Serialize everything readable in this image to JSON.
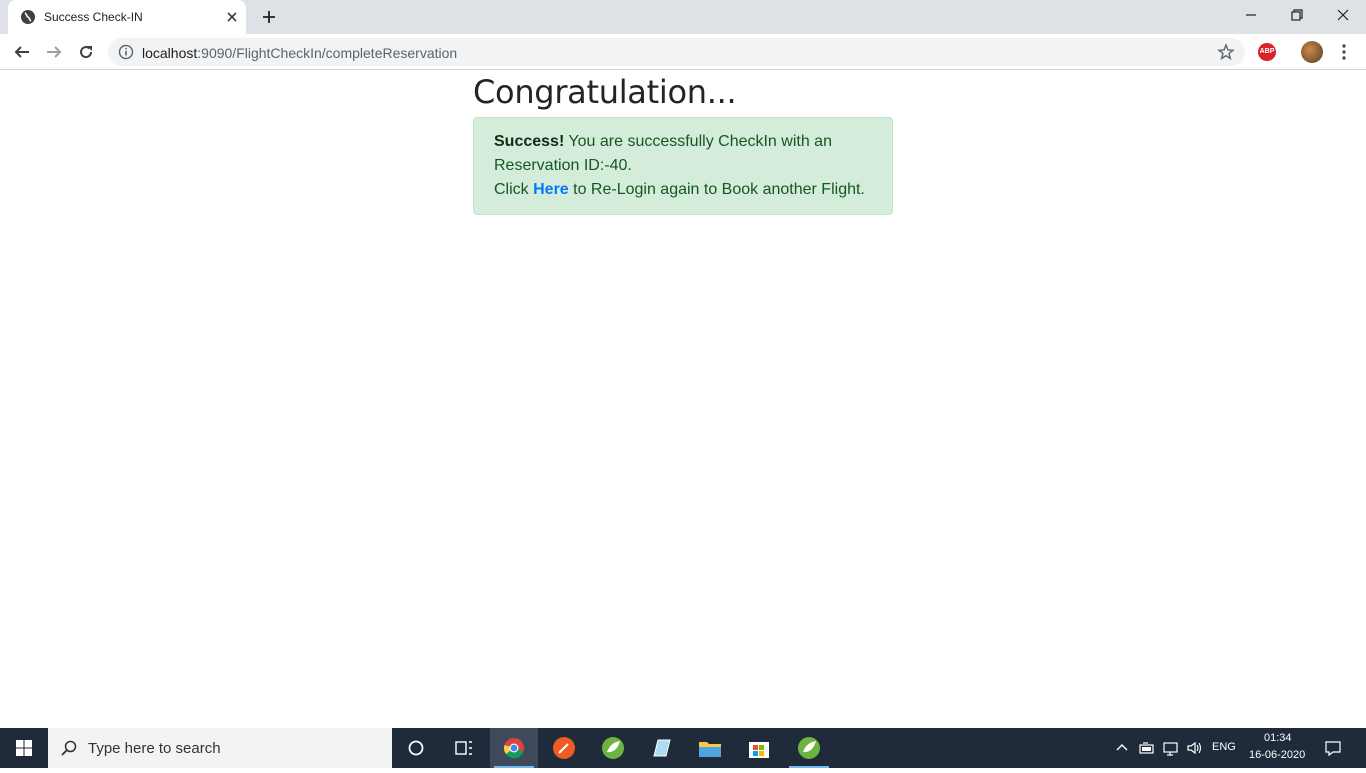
{
  "browser": {
    "tab_title": "Success Check-IN",
    "url_host": "localhost",
    "url_rest": ":9090/FlightCheckIn/completeReservation",
    "abp_label": "ABP"
  },
  "page": {
    "heading": "Congratulation...",
    "alert": {
      "strong": "Success!",
      "line1_rest": " You are successfully CheckIn with an Reservation ID:-40.",
      "click_prefix": "Click ",
      "link_text": "Here",
      "click_suffix": " to Re-Login again to Book another Flight."
    }
  },
  "taskbar": {
    "search_placeholder": "Type here to search",
    "language": "ENG",
    "time": "01:34",
    "date": "16-06-2020"
  },
  "colors": {
    "alert_bg": "#d4edda",
    "alert_text": "#155724",
    "link": "#007bff",
    "taskbar": "#1f2a3a"
  }
}
